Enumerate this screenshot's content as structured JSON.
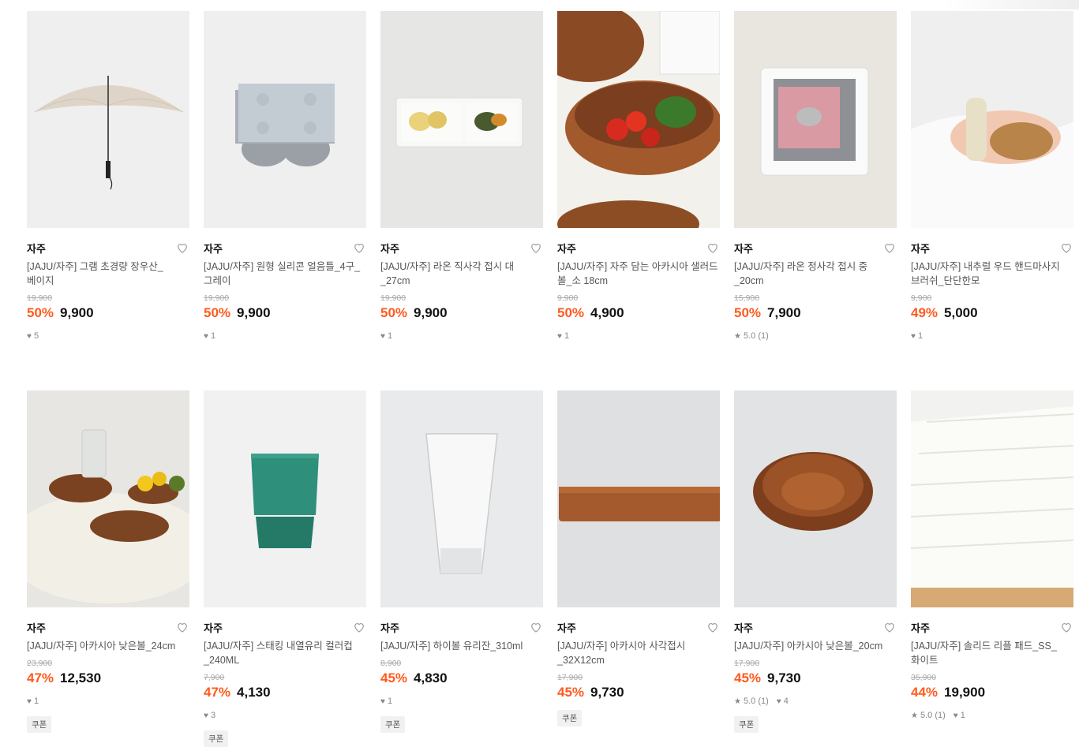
{
  "products": [
    {
      "brand": "자주",
      "title": "[JAJU/자주] 그램 초경량 장우산_베이지",
      "original_price": "19,900",
      "discount": "50%",
      "price": "9,900",
      "likes": "5",
      "rating": "",
      "coupon": ""
    },
    {
      "brand": "자주",
      "title": "[JAJU/자주] 원형 실리콘 얼음틀_4구_그레이",
      "original_price": "19,900",
      "discount": "50%",
      "price": "9,900",
      "likes": "1",
      "rating": "",
      "coupon": ""
    },
    {
      "brand": "자주",
      "title": "[JAJU/자주] 라온 직사각 접시 대_27cm",
      "original_price": "19,900",
      "discount": "50%",
      "price": "9,900",
      "likes": "1",
      "rating": "",
      "coupon": ""
    },
    {
      "brand": "자주",
      "title": "[JAJU/자주] 자주 담는 아카시아 샐러드 볼_소 18cm",
      "original_price": "9,900",
      "discount": "50%",
      "price": "4,900",
      "likes": "1",
      "rating": "",
      "coupon": ""
    },
    {
      "brand": "자주",
      "title": "[JAJU/자주] 라온 정사각 접시 중_20cm",
      "original_price": "15,900",
      "discount": "50%",
      "price": "7,900",
      "likes": "",
      "rating": "5.0 (1)",
      "coupon": ""
    },
    {
      "brand": "자주",
      "title": "[JAJU/자주] 내추럴 우드 핸드마사지 브러쉬_단단한모",
      "original_price": "9,900",
      "discount": "49%",
      "price": "5,000",
      "likes": "1",
      "rating": "",
      "coupon": ""
    },
    {
      "brand": "자주",
      "title": "[JAJU/자주] 아카시아 낮은볼_24cm",
      "original_price": "23,900",
      "discount": "47%",
      "price": "12,530",
      "likes": "1",
      "rating": "",
      "coupon": "쿠폰"
    },
    {
      "brand": "자주",
      "title": "[JAJU/자주] 스태킹 내열유리 컬러컵_240ML",
      "original_price": "7,900",
      "discount": "47%",
      "price": "4,130",
      "likes": "3",
      "rating": "",
      "coupon": "쿠폰"
    },
    {
      "brand": "자주",
      "title": "[JAJU/자주] 하이볼 유리잔_310ml",
      "original_price": "8,900",
      "discount": "45%",
      "price": "4,830",
      "likes": "1",
      "rating": "",
      "coupon": "쿠폰"
    },
    {
      "brand": "자주",
      "title": "[JAJU/자주] 아카시아 사각접시_32X12cm",
      "original_price": "17,900",
      "discount": "45%",
      "price": "9,730",
      "likes": "",
      "rating": "",
      "coupon": "쿠폰"
    },
    {
      "brand": "자주",
      "title": "[JAJU/자주] 아카시아 낮은볼_20cm",
      "original_price": "17,900",
      "discount": "45%",
      "price": "9,730",
      "likes": "4",
      "rating": "5.0 (1)",
      "coupon": "쿠폰"
    },
    {
      "brand": "자주",
      "title": "[JAJU/자주] 솔리드 리플 패드_SS_화이트",
      "original_price": "35,900",
      "discount": "44%",
      "price": "19,900",
      "likes": "1",
      "rating": "5.0 (1)",
      "coupon": ""
    }
  ],
  "icons": {
    "wishlist": "heart-outline-icon",
    "likes": "heart-icon",
    "rating": "star-icon"
  },
  "colors": {
    "discount": "#ff5a1f",
    "price": "#111111",
    "muted": "#888888"
  }
}
